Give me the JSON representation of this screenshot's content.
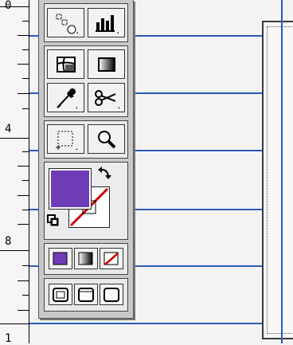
{
  "ruler": {
    "labels": [
      "0",
      "4",
      "8",
      "1"
    ]
  },
  "colors": {
    "guide": "#2a5bb8",
    "fill": "#6f3cb8",
    "none_slash": "#d10000"
  },
  "tools": [
    {
      "name": "graph-data-tool",
      "icon": "dotted-graph-icon"
    },
    {
      "name": "column-graph-tool",
      "icon": "bar-graph-icon"
    },
    {
      "name": "mesh-tool",
      "icon": "mesh-icon"
    },
    {
      "name": "gradient-tool",
      "icon": "gradient-icon"
    },
    {
      "name": "eyedropper-tool",
      "icon": "eyedropper-icon"
    },
    {
      "name": "scissors-tool",
      "icon": "scissors-icon"
    },
    {
      "name": "crop-area-tool",
      "icon": "dotted-rect-icon"
    },
    {
      "name": "zoom-tool",
      "icon": "magnifier-icon"
    }
  ],
  "fill_stroke": {
    "fill": "#6f3cb8",
    "stroke": "none"
  },
  "color_modes": [
    "color",
    "gradient",
    "none"
  ],
  "screen_modes": [
    "standard-screen",
    "full-screen-menu",
    "full-screen"
  ]
}
